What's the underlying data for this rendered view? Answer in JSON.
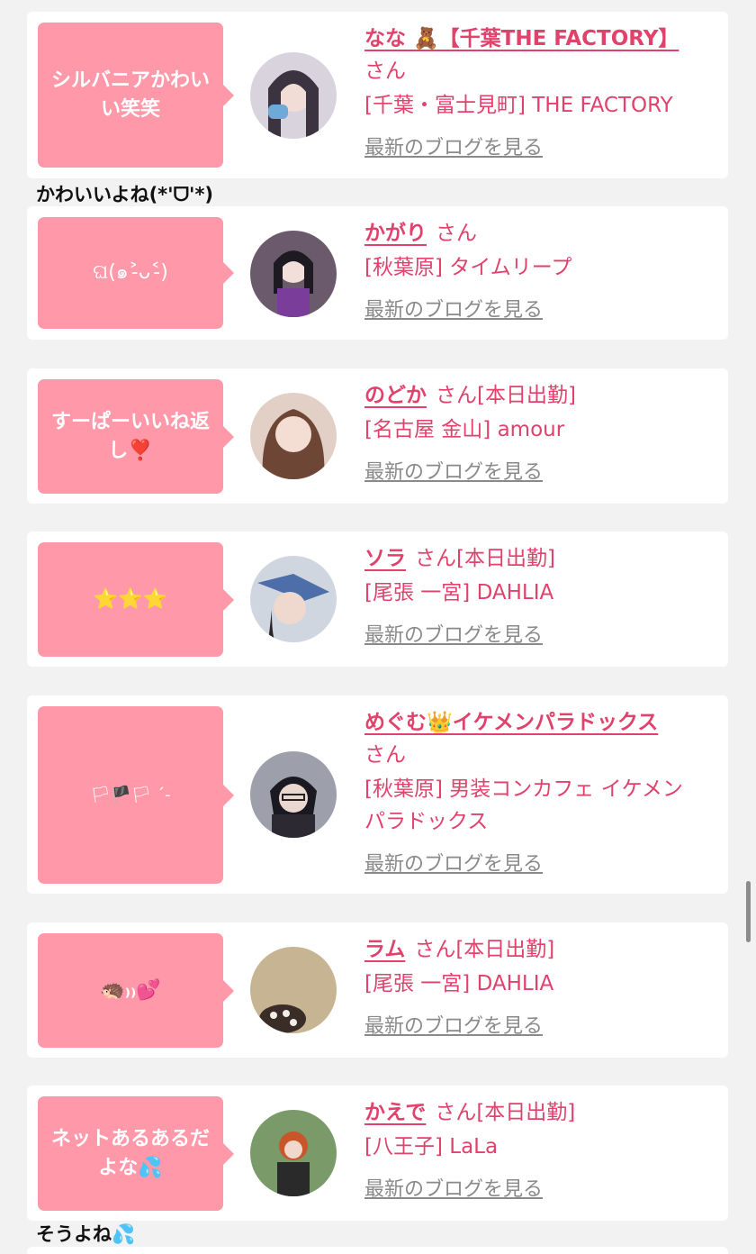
{
  "blog_label": "最新のブログを見る",
  "san_label": "さん",
  "cards": [
    {
      "bubble": "シルバニアかわいい笑笑",
      "name": "なな 🧸【千葉THE FACTORY】",
      "shift": "",
      "shop": "[千葉・富士見町] THE FACTORY",
      "avatar_color": "#c9c4cf"
    },
    {
      "bubble": "ଘ(๑˃̵ᴗ˂̵)",
      "name": "かがり",
      "shift": "",
      "shop": "[秋葉原] タイムリープ",
      "avatar_color": "#5c4a63"
    },
    {
      "bubble": "すーぱーいいね返し❣️",
      "name": "のどか",
      "shift": "[本日出勤]",
      "shop": "[名古屋 金山] amour",
      "avatar_color": "#d7b3a5"
    },
    {
      "bubble": "⭐️⭐️⭐️",
      "name": "ソラ",
      "shift": "[本日出勤]",
      "shop": "[尾張 一宮] DAHLIA",
      "avatar_color": "#8c9fb8"
    },
    {
      "bubble": "🏳🏴🏳 ´-",
      "name": "めぐむ👑イケメンパラドックス",
      "shift": "",
      "shop": "[秋葉原] 男装コンカフェ イケメンパラドックス",
      "avatar_color": "#3a3440"
    },
    {
      "bubble": "🦔₎₎💕",
      "name": "ラム",
      "shift": "[本日出勤]",
      "shop": "[尾張 一宮] DAHLIA",
      "avatar_color": "#b9a47e"
    },
    {
      "bubble": "ネットあるあるだよな💦",
      "name": "かえで",
      "shift": "[本日出勤]",
      "shop": "[八王子] LaLa",
      "avatar_color": "#6f8b5e"
    }
  ],
  "comments": [
    "かわいいよね(*'ᗜ'*)",
    "そうよね💦"
  ]
}
